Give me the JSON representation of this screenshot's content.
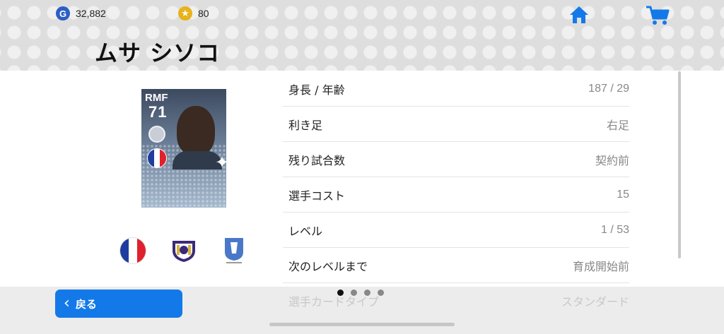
{
  "header": {
    "gp": {
      "icon": "g-coin-icon",
      "value": "32,882"
    },
    "coins": {
      "icon": "star-coin-icon",
      "value": "80"
    },
    "player_name": "ムサ シソコ",
    "home_icon": "home-icon",
    "cart_icon": "cart-icon"
  },
  "card": {
    "position": "RMF",
    "rating": "71"
  },
  "stats": [
    {
      "label": "身長 / 年齢",
      "value": "187 / 29"
    },
    {
      "label": "利き足",
      "value": "右足"
    },
    {
      "label": "残り試合数",
      "value": "契約前"
    },
    {
      "label": "選手コスト",
      "value": "15"
    },
    {
      "label": "レベル",
      "value": "1 / 53"
    },
    {
      "label": "次のレベルまで",
      "value": "育成開始前"
    }
  ],
  "faded_row": {
    "label": "選手カードタイプ",
    "value": "スタンダード"
  },
  "footer": {
    "back_label": "戻る",
    "pages": 4,
    "active_page": 1
  },
  "colors": {
    "accent": "#1479e8",
    "gp": "#2a5fc4",
    "coin": "#e7b21b"
  }
}
